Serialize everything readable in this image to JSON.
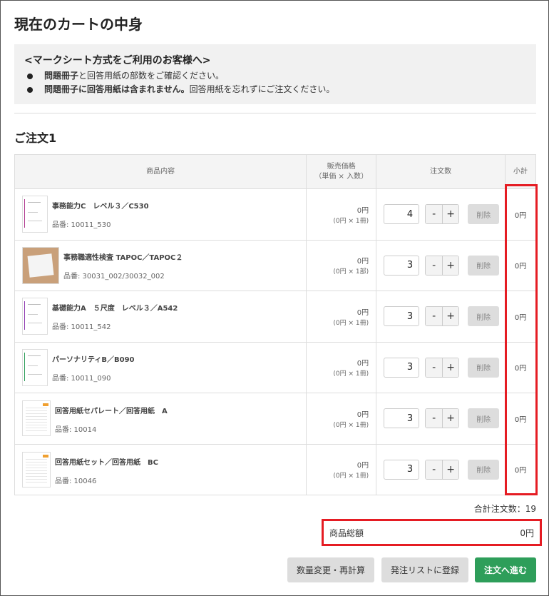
{
  "page": {
    "title": "現在のカートの中身"
  },
  "notice": {
    "heading": "<マークシート方式をご利用のお客様へ>",
    "line1_bold": "問題冊子",
    "line1_rest": "と回答用紙の部数をご確認ください。",
    "line2_bold": "問題冊子に回答用紙は含まれません。",
    "line2_rest": "回答用紙を忘れずにご注文ください。"
  },
  "order": {
    "title": "ご注文1"
  },
  "table": {
    "headers": {
      "product": "商品内容",
      "price_line1": "販売価格",
      "price_line2": "（単価 × 入数）",
      "qty": "注文数",
      "subtotal": "小計"
    },
    "rows": [
      {
        "name": "事務能力C　レベル３／C530",
        "code": "品番: 10011_530",
        "price": "0円",
        "detail": "(0円 × 1冊)",
        "qty": "4",
        "minus": "-",
        "plus": "+",
        "delete": "削除",
        "subtotal": "0円",
        "thumb": "booklet",
        "spine_color": "#b03a8e"
      },
      {
        "name": "事務職適性検査 TAPOC／TAPOC２",
        "code": "品番: 30031_002/30032_002",
        "price": "0円",
        "detail": "(0円 × 1部)",
        "qty": "3",
        "minus": "-",
        "plus": "+",
        "delete": "削除",
        "subtotal": "0円",
        "thumb": "photo",
        "spine_color": "#d9534f"
      },
      {
        "name": "基礎能力A　５尺度　レベル３／A542",
        "code": "品番: 10011_542",
        "price": "0円",
        "detail": "(0円 × 1冊)",
        "qty": "3",
        "minus": "-",
        "plus": "+",
        "delete": "削除",
        "subtotal": "0円",
        "thumb": "booklet",
        "spine_color": "#8e3ab0"
      },
      {
        "name": "パーソナリティB／B090",
        "code": "品番: 10011_090",
        "price": "0円",
        "detail": "(0円 × 1冊)",
        "qty": "3",
        "minus": "-",
        "plus": "+",
        "delete": "削除",
        "subtotal": "0円",
        "thumb": "booklet",
        "spine_color": "#2e9e5a"
      },
      {
        "name": "回答用紙セパレート／回答用紙　A",
        "code": "品番: 10014",
        "price": "0円",
        "detail": "(0円 × 1冊)",
        "qty": "3",
        "minus": "-",
        "plus": "+",
        "delete": "削除",
        "subtotal": "0円",
        "thumb": "sheet",
        "spine_color": "#f0a030"
      },
      {
        "name": "回答用紙セット／回答用紙　BC",
        "code": "品番: 10046",
        "price": "0円",
        "detail": "(0円 × 1冊)",
        "qty": "3",
        "minus": "-",
        "plus": "+",
        "delete": "削除",
        "subtotal": "0円",
        "thumb": "sheet",
        "spine_color": "#e0b0a0"
      }
    ]
  },
  "summary": {
    "total_count": "合計注文数：19",
    "total_label": "商品総額",
    "total_value": "0円"
  },
  "buttons": {
    "recalc": "数量変更・再計算",
    "save_list": "発注リストに登録",
    "proceed": "注文へ進む"
  },
  "colors": {
    "accent_green": "#2e9e5a",
    "highlight_red": "#e51c23"
  }
}
